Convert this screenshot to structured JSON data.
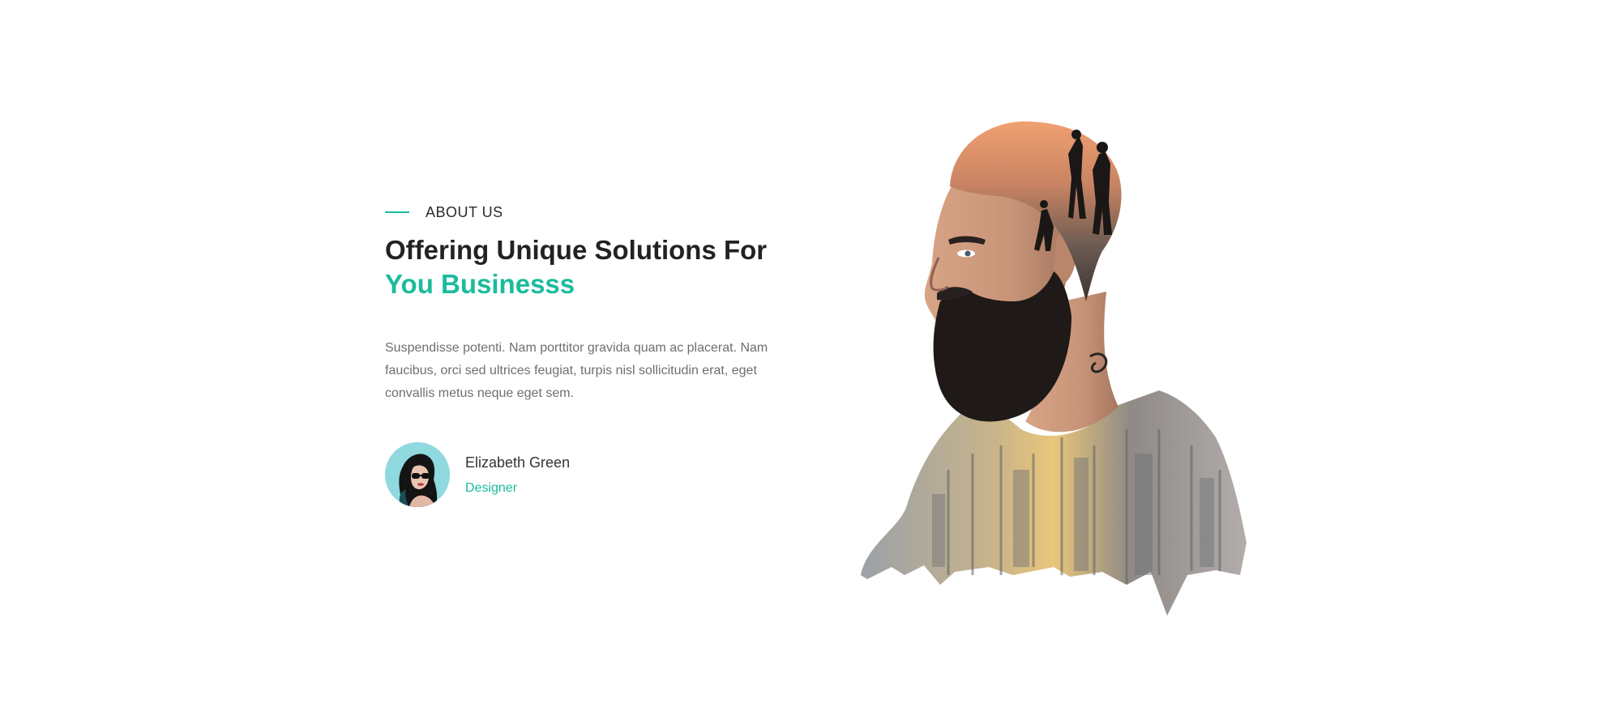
{
  "about": {
    "eyebrow": "ABOUT US",
    "heading_line1": "Offering Unique Solutions For",
    "heading_line2": "You Businesss",
    "paragraph": "Suspendisse potenti. Nam porttitor gravida quam ac placerat. Nam faucibus, orci sed ultrices feugiat, turpis nisl sollicitudin erat, eget convallis metus neque eget sem.",
    "author": {
      "name": "Elizabeth Green",
      "role": "Designer"
    }
  },
  "colors": {
    "accent": "#1abc9c",
    "heading": "#222222",
    "body_text": "#6f6f6f",
    "avatar_bg": "#8fd9df"
  }
}
